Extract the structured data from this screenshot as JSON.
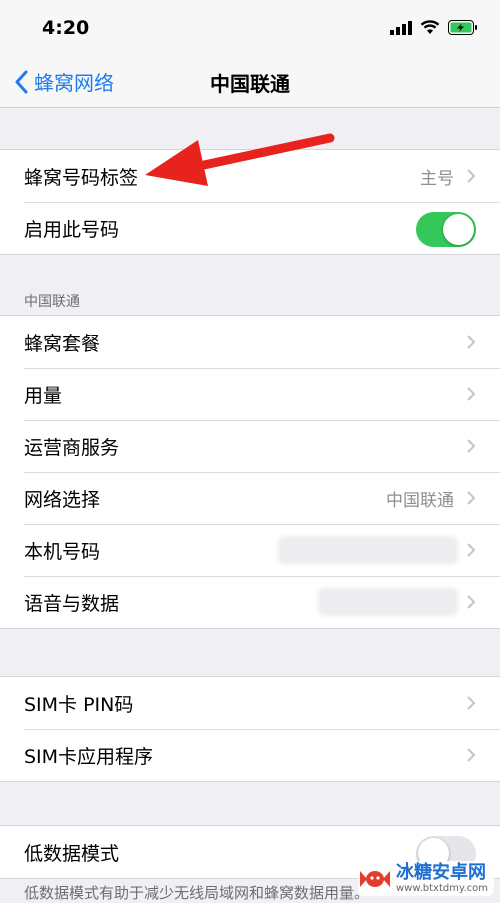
{
  "status": {
    "time": "4:20"
  },
  "nav": {
    "back_label": "蜂窝网络",
    "title": "中国联通"
  },
  "group1": {
    "rows": [
      {
        "label": "蜂窝号码标签",
        "value": "主号"
      },
      {
        "label": "启用此号码",
        "toggle_on": true
      }
    ]
  },
  "section_carrier": {
    "header": "中国联通",
    "rows": [
      {
        "label": "蜂窝套餐"
      },
      {
        "label": "用量"
      },
      {
        "label": "运营商服务"
      },
      {
        "label": "网络选择",
        "value": "中国联通"
      },
      {
        "label": "本机号码",
        "value_blurred": true
      },
      {
        "label": "语音与数据",
        "value_blurred": true
      }
    ]
  },
  "group_sim": {
    "rows": [
      {
        "label": "SIM卡 PIN码"
      },
      {
        "label": "SIM卡应用程序"
      }
    ]
  },
  "group_lowdata": {
    "rows": [
      {
        "label": "低数据模式",
        "toggle_on": false
      }
    ],
    "footer": "低数据模式有助于减少无线局域网和蜂窝数据用量。"
  },
  "annotation": {
    "arrow_color": "#e8231d"
  },
  "watermark": {
    "title": "冰糖安卓网",
    "url": "www.btxtdmy.com"
  },
  "colors": {
    "accent": "#1f7cf0",
    "toggle_on": "#34c759"
  }
}
